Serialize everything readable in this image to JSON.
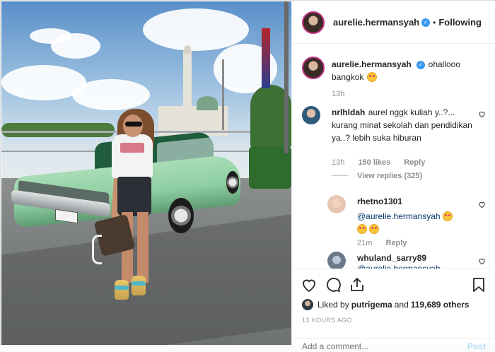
{
  "header": {
    "username": "aurelie.hermansyah",
    "separator": "•",
    "follow_status": "Following"
  },
  "caption": {
    "username": "aurelie.hermansyah",
    "text": "ohallooo bangkok",
    "emoji": "heart-eyes-emoji",
    "time": "13h"
  },
  "comments": [
    {
      "username": "nrlhldah",
      "text": "aurel nggk kuliah y..?... kurang minat sekolah dan pendidikan ya..? lebih suka hiburan",
      "time": "13h",
      "likes": "150 likes",
      "reply": "Reply",
      "view_replies": "View replies (325)"
    },
    {
      "username": "rhetno1301",
      "mention": "@aurelie.hermansyah",
      "time": "21m",
      "reply": "Reply"
    },
    {
      "username": "whuland_sarry89",
      "text": "@aurelie.hermansyah"
    }
  ],
  "liked_by": {
    "prefix": "Liked by",
    "user": "putrigema",
    "and": "and",
    "count": "119,689 others"
  },
  "timestamp": "13 HOURS AGO",
  "add_comment": {
    "placeholder": "Add a comment...",
    "post_label": "Post"
  },
  "colors": {
    "verified": "#3897f0",
    "mention": "#003569",
    "story_ring": "#c13584"
  }
}
